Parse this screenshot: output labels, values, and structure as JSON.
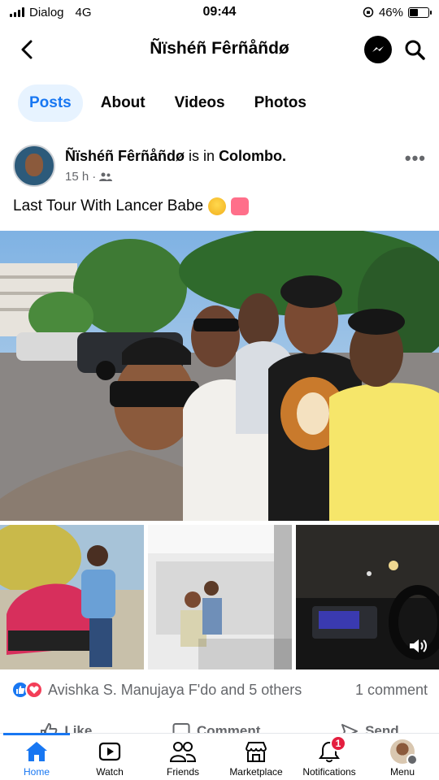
{
  "status_bar": {
    "carrier": "Dialog",
    "network": "4G",
    "time": "09:44",
    "battery": "46%",
    "battery_level": 0.46
  },
  "header": {
    "title": "Ñïshéñ Fêrñåñdø"
  },
  "tabs": [
    {
      "label": "Posts",
      "active": true
    },
    {
      "label": "About",
      "active": false
    },
    {
      "label": "Videos",
      "active": false
    },
    {
      "label": "Photos",
      "active": false
    }
  ],
  "post": {
    "author": "Ñïshéñ Fêrñåñdø",
    "is_in": "is in",
    "location": "Colombo.",
    "time": "15 h",
    "audience_icon": "friends-icon",
    "text": "Last Tour With Lancer Babe",
    "reactions_text": "Avishka S. Manujaya F'do and 5 others",
    "comments": "1 comment"
  },
  "actions": {
    "like": "Like",
    "comment": "Comment",
    "send": "Send"
  },
  "bottom_nav": [
    {
      "label": "Home",
      "icon": "home-icon",
      "active": true
    },
    {
      "label": "Watch",
      "icon": "watch-icon",
      "active": false
    },
    {
      "label": "Friends",
      "icon": "friends-icon",
      "active": false
    },
    {
      "label": "Marketplace",
      "icon": "marketplace-icon",
      "active": false
    },
    {
      "label": "Notifications",
      "icon": "bell-icon",
      "active": false,
      "badge": "1"
    },
    {
      "label": "Menu",
      "icon": "menu-avatar-icon",
      "active": false
    }
  ],
  "colors": {
    "accent": "#1877f2",
    "tab_active_bg": "#e7f3ff",
    "secondary_text": "#65676b",
    "badge": "#e41e3f"
  }
}
